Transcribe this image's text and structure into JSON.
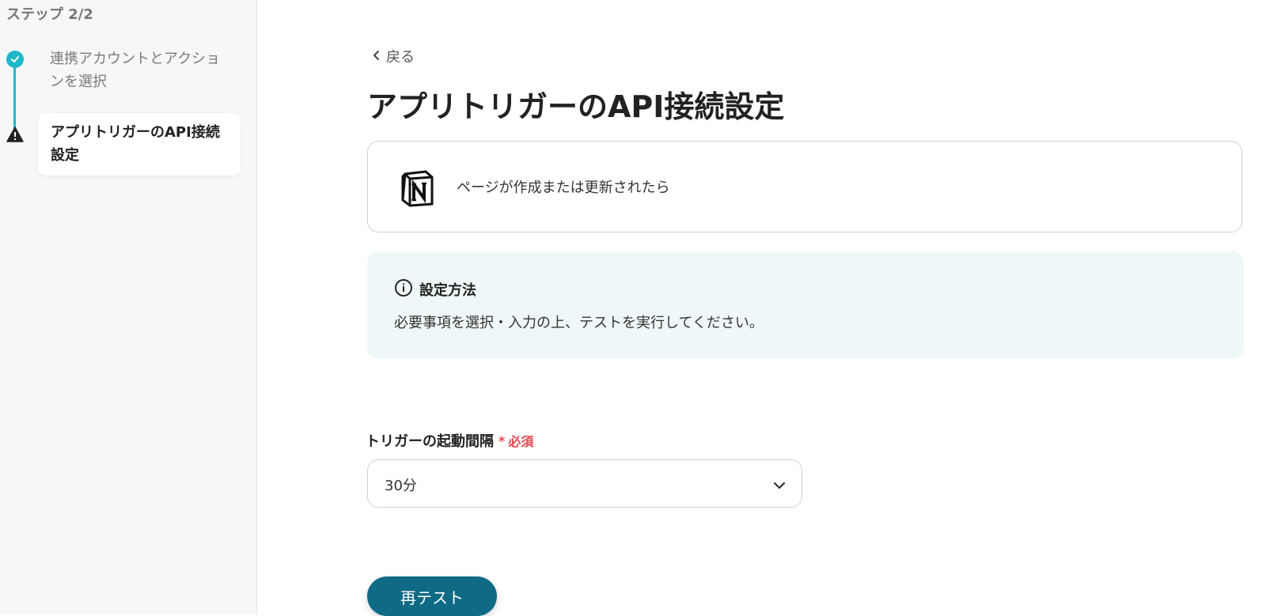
{
  "sidebar": {
    "step_counter": "ステップ 2/2",
    "steps": [
      {
        "label": "連携アカウントとアクションを選択",
        "status": "complete"
      },
      {
        "label": "アプリトリガーのAPI接続設定",
        "status": "warning"
      }
    ]
  },
  "main": {
    "back_label": "戻る",
    "title": "アプリトリガーのAPI接続設定",
    "trigger": {
      "app_icon": "notion-logo-icon",
      "label": "ページが作成または更新されたら"
    },
    "info": {
      "icon": "info-icon",
      "title": "設定方法",
      "body": "必要事項を選択・入力の上、テストを実行してください。"
    },
    "interval_field": {
      "label": "トリガーの起動間隔",
      "required_mark": "*",
      "required_label": "必須",
      "value": "30分"
    },
    "retest_button": "再テスト"
  },
  "colors": {
    "accent": "#1fb8c9",
    "primary_button": "#0f6b85",
    "required": "#e5484d",
    "info_background": "#eff8f8"
  }
}
